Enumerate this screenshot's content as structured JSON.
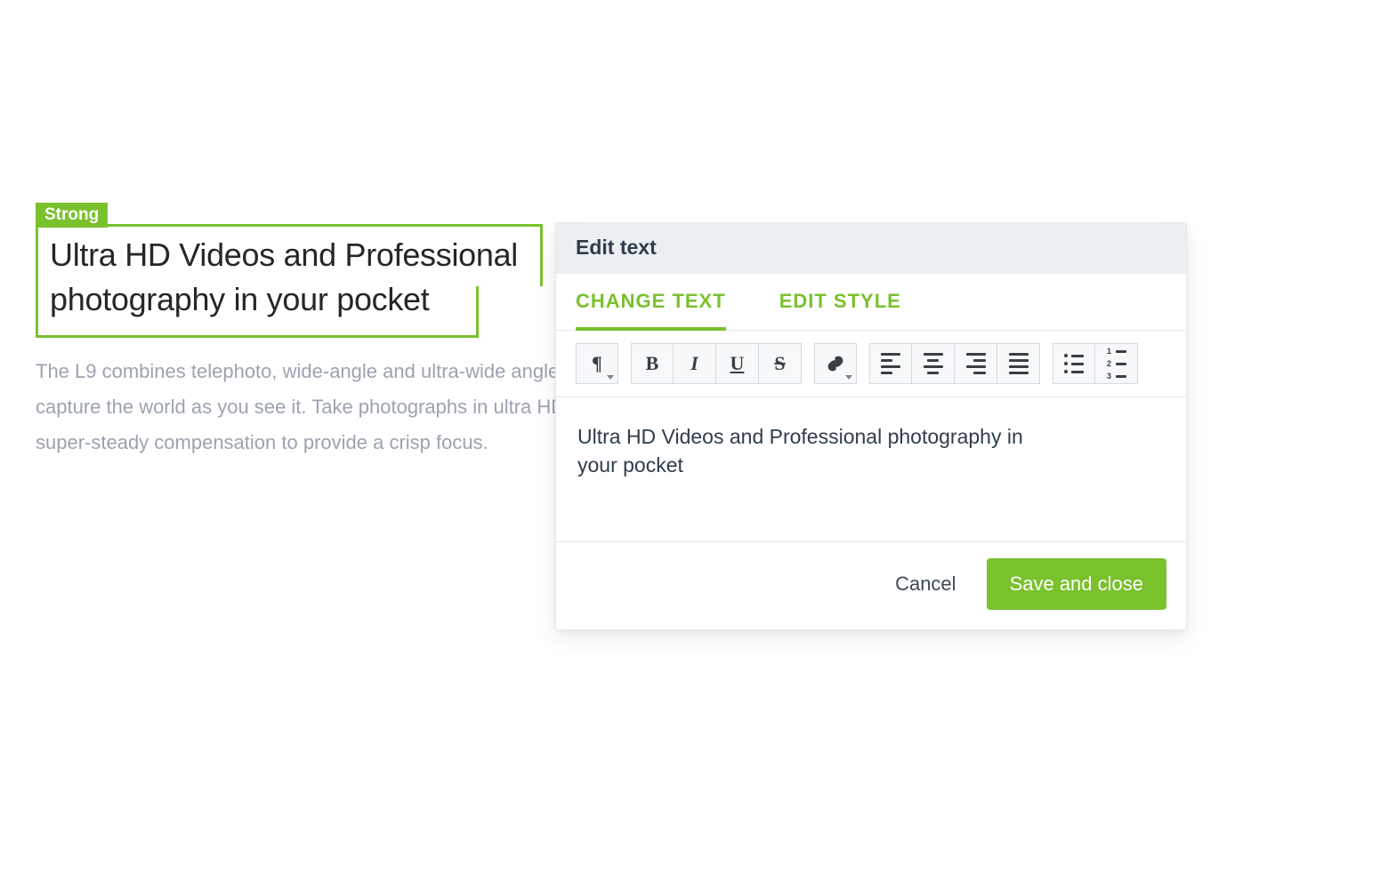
{
  "colors": {
    "accent": "#7ac12e",
    "text_dark": "#2f3d4a",
    "text_muted": "#9ca3af"
  },
  "content": {
    "selection_tag": "Strong",
    "heading": "Ultra HD Videos and Professional photography in your pocket",
    "paragraph": "The L9 combines telephoto, wide-angle and ultra-wide angle lenses to capture the world as you see it. Take photographs in ultra HD, with super-steady compensation to provide a crisp focus."
  },
  "popover": {
    "title": "Edit text",
    "tabs": {
      "change_text": "CHANGE TEXT",
      "edit_style": "EDIT STYLE",
      "active": "change_text"
    },
    "toolbar": {
      "paragraph_format": "paragraph-format",
      "bold": "B",
      "italic": "I",
      "underline": "U",
      "strike": "S",
      "link": "link",
      "align_left": "align-left",
      "align_center": "align-center",
      "align_right": "align-right",
      "align_justify": "align-justify",
      "list_bullet": "bullet-list",
      "list_number": "numbered-list"
    },
    "editor_text": "Ultra HD Videos and Professional photography in your pocket",
    "cancel_label": "Cancel",
    "save_label": "Save and close"
  }
}
